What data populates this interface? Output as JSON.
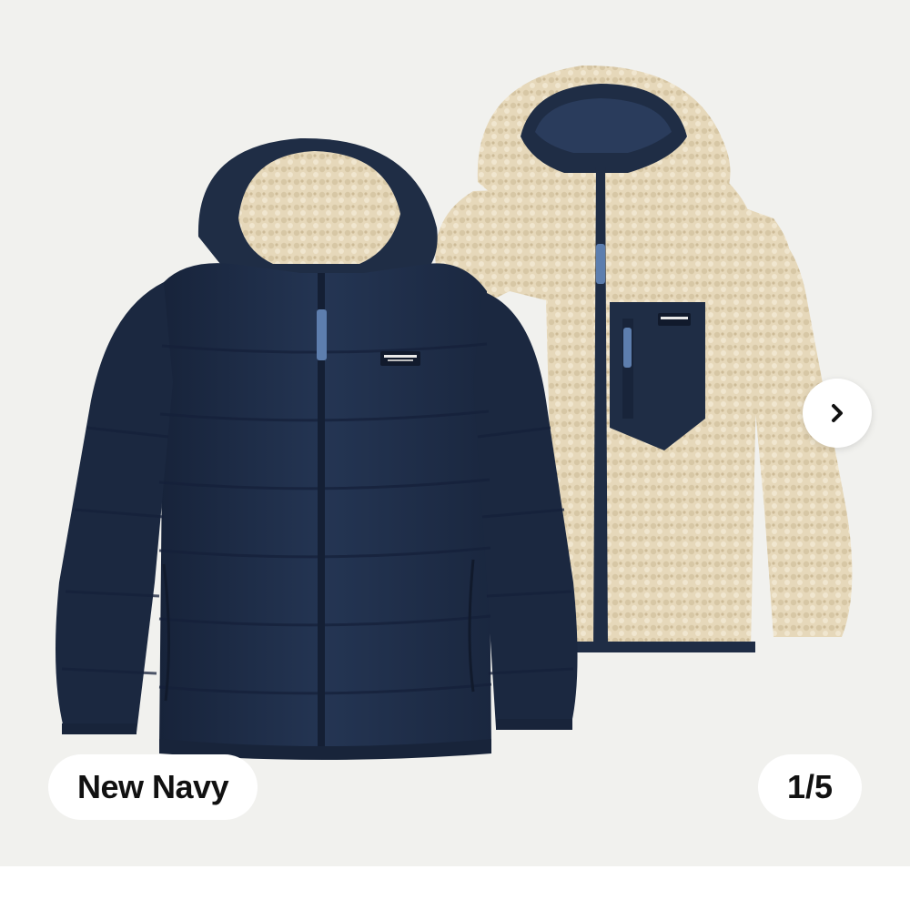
{
  "gallery": {
    "color_name": "New Navy",
    "counter": "1/5",
    "next_icon": "chevron-right-icon",
    "logo_text": "patagonia",
    "colors": {
      "background": "#f1f1ee",
      "navy": "#1f2d45",
      "sherpa": "#e6d8ba",
      "zipper_pull": "#5d7eae"
    }
  }
}
